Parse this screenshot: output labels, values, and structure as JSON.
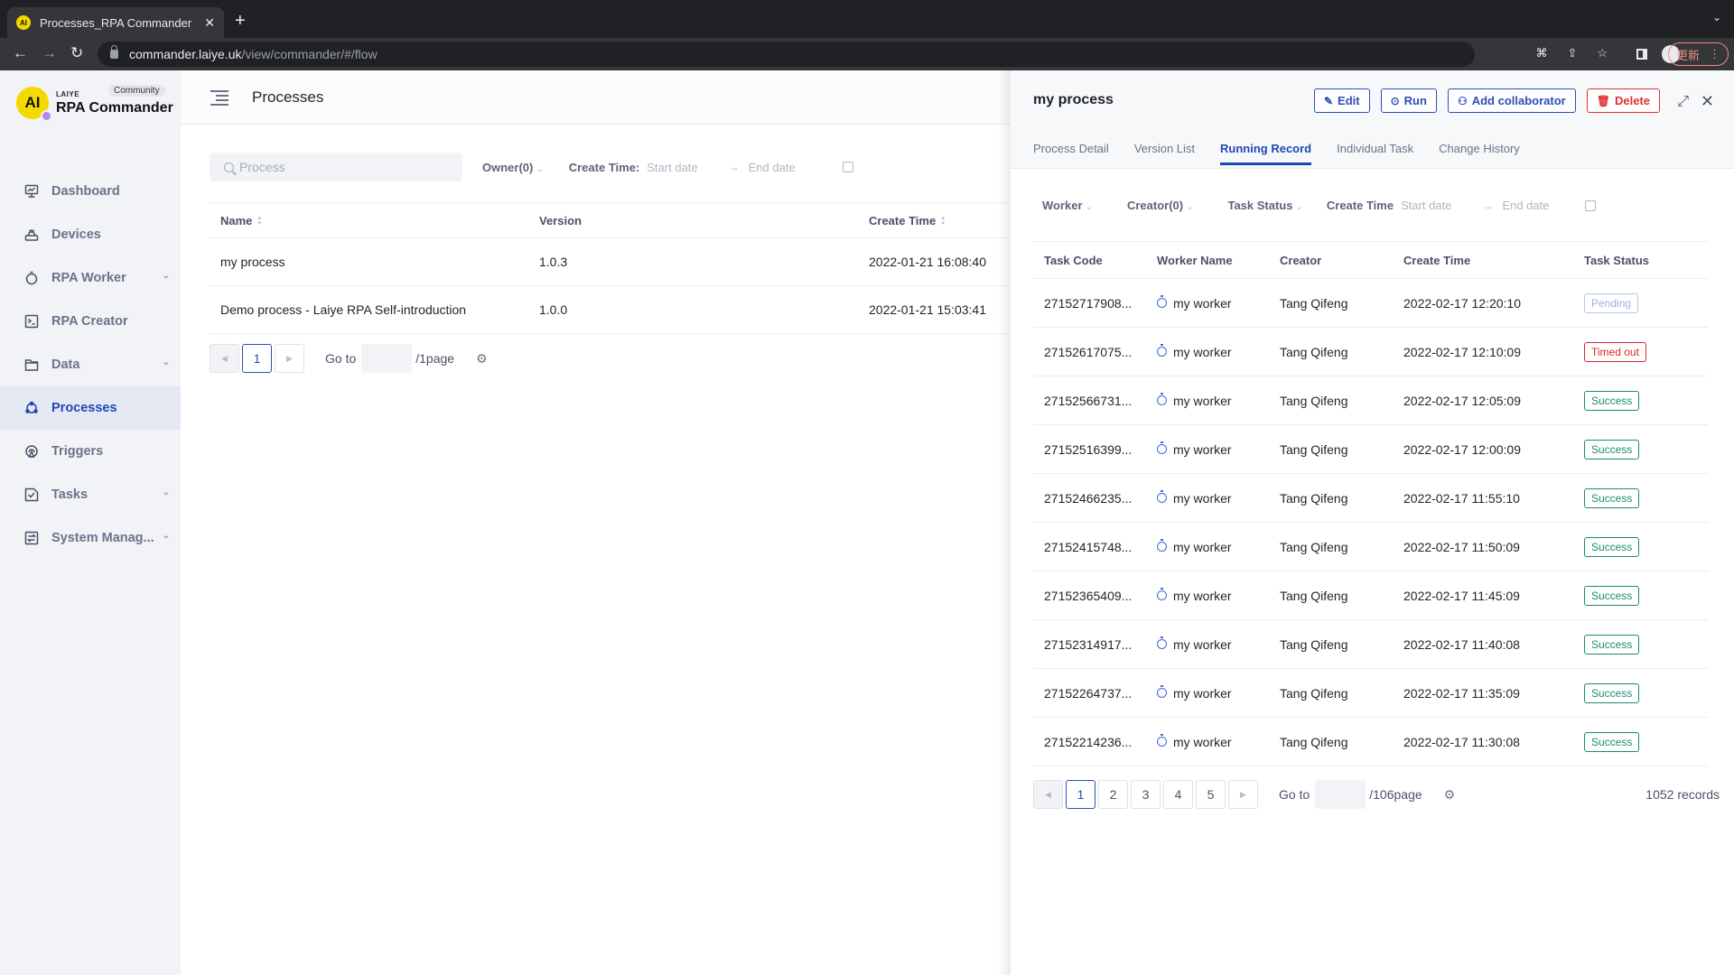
{
  "browser": {
    "tab_title": "Processes_RPA Commander",
    "url_host": "commander.laiye.uk",
    "url_path": "/view/commander/#/flow",
    "update_label": "更新"
  },
  "sidebar": {
    "brand_small": "LAIYE",
    "brand_name": "RPA Commander",
    "edition_badge": "Community",
    "items": [
      {
        "label": "Dashboard",
        "icon": "dashboard-icon",
        "expandable": false
      },
      {
        "label": "Devices",
        "icon": "devices-icon",
        "expandable": false
      },
      {
        "label": "RPA Worker",
        "icon": "worker-icon",
        "expandable": true
      },
      {
        "label": "RPA Creator",
        "icon": "terminal-icon",
        "expandable": false
      },
      {
        "label": "Data",
        "icon": "folder-icon",
        "expandable": true
      },
      {
        "label": "Processes",
        "icon": "processes-icon",
        "expandable": false,
        "active": true
      },
      {
        "label": "Triggers",
        "icon": "trigger-icon",
        "expandable": false
      },
      {
        "label": "Tasks",
        "icon": "tasks-icon",
        "expandable": true
      },
      {
        "label": "System Manag...",
        "icon": "system-icon",
        "expandable": true
      }
    ]
  },
  "main": {
    "title": "Processes",
    "search_placeholder": "Process",
    "owner_filter": "Owner(0)",
    "create_time_label": "Create Time:",
    "start_date_placeholder": "Start date",
    "end_date_placeholder": "End date",
    "columns": [
      "Name",
      "Version",
      "Create Time"
    ],
    "rows": [
      {
        "name": "my process",
        "version": "1.0.3",
        "create_time": "2022-01-21 16:08:40"
      },
      {
        "name": "Demo process - Laiye RPA Self-introduction",
        "version": "1.0.0",
        "create_time": "2022-01-21 15:03:41"
      }
    ],
    "pager": {
      "current": "1",
      "goto_label": "Go to",
      "total_label": "/1page"
    }
  },
  "drawer": {
    "title": "my process",
    "buttons": {
      "edit": "Edit",
      "run": "Run",
      "add_collaborator": "Add collaborator",
      "delete": "Delete"
    },
    "tabs": [
      "Process Detail",
      "Version List",
      "Running Record",
      "Individual Task",
      "Change History"
    ],
    "active_tab": "Running Record",
    "filters": {
      "worker": "Worker",
      "creator": "Creator(0)",
      "task_status": "Task Status",
      "create_time": "Create Time",
      "start_date": "Start date",
      "end_date": "End date"
    },
    "columns": [
      "Task Code",
      "Worker Name",
      "Creator",
      "Create Time",
      "Task Status"
    ],
    "rows": [
      {
        "code": "27152717908...",
        "worker": "my worker",
        "creator": "Tang Qifeng",
        "time": "2022-02-17 12:20:10",
        "status": "Pending"
      },
      {
        "code": "27152617075...",
        "worker": "my worker",
        "creator": "Tang Qifeng",
        "time": "2022-02-17 12:10:09",
        "status": "Timed out"
      },
      {
        "code": "27152566731...",
        "worker": "my worker",
        "creator": "Tang Qifeng",
        "time": "2022-02-17 12:05:09",
        "status": "Success"
      },
      {
        "code": "27152516399...",
        "worker": "my worker",
        "creator": "Tang Qifeng",
        "time": "2022-02-17 12:00:09",
        "status": "Success"
      },
      {
        "code": "27152466235...",
        "worker": "my worker",
        "creator": "Tang Qifeng",
        "time": "2022-02-17 11:55:10",
        "status": "Success"
      },
      {
        "code": "27152415748...",
        "worker": "my worker",
        "creator": "Tang Qifeng",
        "time": "2022-02-17 11:50:09",
        "status": "Success"
      },
      {
        "code": "27152365409...",
        "worker": "my worker",
        "creator": "Tang Qifeng",
        "time": "2022-02-17 11:45:09",
        "status": "Success"
      },
      {
        "code": "27152314917...",
        "worker": "my worker",
        "creator": "Tang Qifeng",
        "time": "2022-02-17 11:40:08",
        "status": "Success"
      },
      {
        "code": "27152264737...",
        "worker": "my worker",
        "creator": "Tang Qifeng",
        "time": "2022-02-17 11:35:09",
        "status": "Success"
      },
      {
        "code": "27152214236...",
        "worker": "my worker",
        "creator": "Tang Qifeng",
        "time": "2022-02-17 11:30:08",
        "status": "Success"
      }
    ],
    "pager": {
      "pages": [
        "1",
        "2",
        "3",
        "4",
        "5"
      ],
      "current": "1",
      "goto_label": "Go to",
      "total_label": "/106page",
      "records": "1052 records"
    }
  },
  "colors": {
    "accent": "#1f46b8",
    "danger": "#e03131",
    "success": "#1a8c72",
    "pending": "#9cb0e6"
  }
}
